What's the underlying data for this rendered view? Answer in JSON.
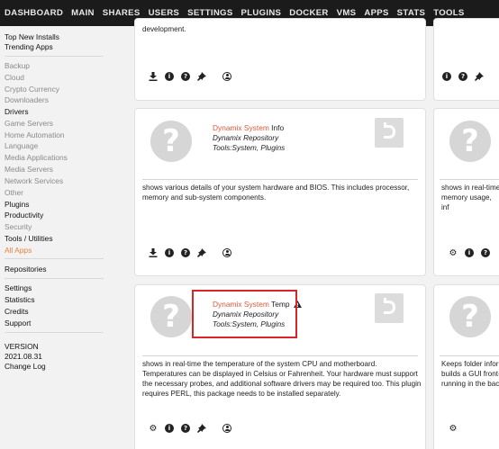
{
  "nav": {
    "items": [
      "DASHBOARD",
      "MAIN",
      "SHARES",
      "USERS",
      "SETTINGS",
      "PLUGINS",
      "DOCKER",
      "VMS",
      "APPS",
      "STATS",
      "TOOLS"
    ],
    "active": "APPS"
  },
  "sidebar": {
    "top_new_installs": "Top New Installs",
    "trending_apps": "Trending Apps",
    "categories": [
      {
        "label": "Backup",
        "state": "muted"
      },
      {
        "label": "Cloud",
        "state": "muted"
      },
      {
        "label": "Crypto Currency",
        "state": "muted"
      },
      {
        "label": "Downloaders",
        "state": "muted"
      },
      {
        "label": "Drivers",
        "state": "normal"
      },
      {
        "label": "Game Servers",
        "state": "muted"
      },
      {
        "label": "Home Automation",
        "state": "muted"
      },
      {
        "label": "Language",
        "state": "muted"
      },
      {
        "label": "Media Applications",
        "state": "muted"
      },
      {
        "label": "Media Servers",
        "state": "muted"
      },
      {
        "label": "Network Services",
        "state": "muted"
      },
      {
        "label": "Other",
        "state": "muted"
      },
      {
        "label": "Plugins",
        "state": "normal"
      },
      {
        "label": "Productivity",
        "state": "normal"
      },
      {
        "label": "Security",
        "state": "muted"
      },
      {
        "label": "Tools / Utilities",
        "state": "normal"
      },
      {
        "label": "All Apps",
        "state": "active"
      }
    ],
    "repositories": "Repositories",
    "settings": "Settings",
    "statistics": "Statistics",
    "credits": "Credits",
    "support": "Support",
    "version_label": "VERSION",
    "version": "2021.08.31",
    "changelog": "Change Log"
  },
  "cards": {
    "top_partial_desc": "development.",
    "info": {
      "author": "Dynamix System",
      "name": "Info",
      "repo": "Dynamix Repository",
      "categories": "Tools:System, Plugins",
      "description": "shows various details of your system hardware and BIOS. This includes processor, memory and sub-system components."
    },
    "temp": {
      "author": "Dynamix System",
      "name": "Temp",
      "repo": "Dynamix Repository",
      "categories": "Tools:System, Plugins",
      "description": "shows in real-time the temperature of the system CPU and motherboard. Temperatures can be displayed in Celsius or Fahrenheit. Your hardware must support the necessary probes, and additional software drivers may be required too. This plugin requires PERL, this package needs to be installed separately."
    },
    "right_info_desc": "shows in real-time memory usage, inf",
    "right_bottom_desc": "Keeps folder infor builds a GUI front- running in the bac"
  },
  "icons": {
    "app_placeholder": "question-mark-icon",
    "badge": "plugin-badge-icon",
    "download": "download-icon",
    "info": "info-icon",
    "help": "help-icon",
    "pin": "pin-icon",
    "settings": "gear-icon",
    "profile": "user-profile-icon",
    "warning": "warning-icon"
  },
  "colors": {
    "nav_bg": "#1c1b1b",
    "accent_orange": "#f0803c",
    "author_red": "#e05a3a",
    "highlight_red": "#d9252a"
  }
}
